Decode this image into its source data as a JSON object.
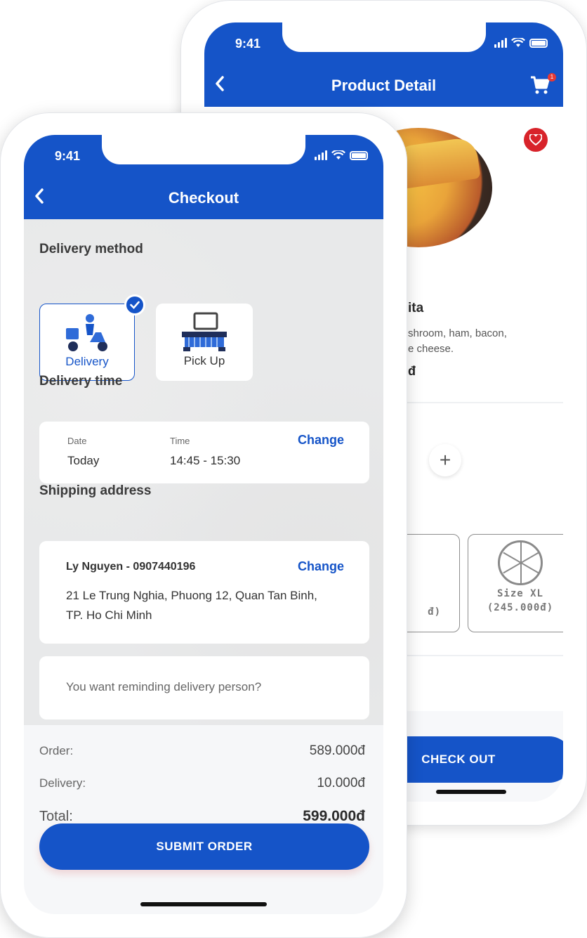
{
  "back_screen": {
    "status_time": "9:41",
    "title": "Product Detail",
    "back_icon": "chevron-left-icon",
    "cart_icon": "cart-icon",
    "cart_badge": "1",
    "favorite_icon": "heart-icon",
    "product_name": "ita",
    "product_desc_line1": "shroom, ham, bacon,",
    "product_desc_line2": "e cheese.",
    "product_price": "đ",
    "plus_label": "+",
    "size_a_price": "đ)",
    "size_xl_label": "Size XL",
    "size_xl_price": "(245.000đ)",
    "checkout_label": "CHECK OUT"
  },
  "front_screen": {
    "status_time": "9:41",
    "title": "Checkout",
    "back_icon": "chevron-left-icon",
    "delivery_method_title": "Delivery method",
    "methods": [
      {
        "label": "Delivery",
        "icon": "scooter-delivery-icon",
        "selected": true
      },
      {
        "label": "Pick Up",
        "icon": "pickup-counter-icon",
        "selected": false
      }
    ],
    "delivery_time_title": "Delivery time",
    "date_label": "Date",
    "date_value": "Today",
    "time_label": "Time",
    "time_value": "14:45 - 15:30",
    "change_label": "Change",
    "shipping_address_title": "Shipping address",
    "address_name": "Ly Nguyen - 0907440196",
    "address_line1": "21 Le Trung Nghia, Phuong 12, Quan Tan Binh,",
    "address_line2": "TP. Ho Chi Minh",
    "remind_placeholder": "You want reminding delivery person?",
    "order_label": "Order:",
    "order_value": "589.000đ",
    "delivery_label": "Delivery:",
    "delivery_value": "10.000đ",
    "total_label": "Total:",
    "total_value": "599.000đ",
    "submit_label": "SUBMIT ORDER"
  },
  "colors": {
    "brand_blue": "#1554c8",
    "favorite_red": "#d8232a"
  }
}
